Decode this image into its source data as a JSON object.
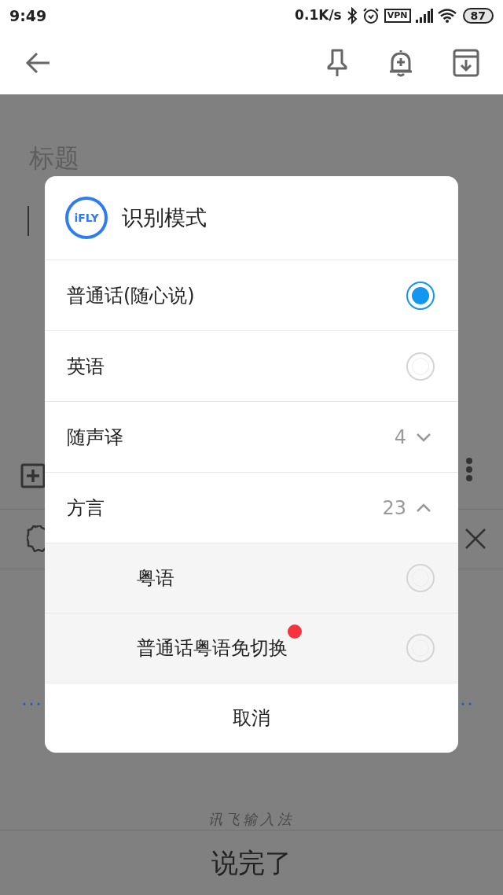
{
  "status_bar": {
    "time": "9:49",
    "speed": "0.1K/s",
    "vpn": "VPN",
    "battery": "87"
  },
  "note": {
    "title_placeholder": "标题"
  },
  "dialog": {
    "logo": "iFLY",
    "title": "识别模式",
    "options": [
      {
        "kind": "radio",
        "label": "普通话(随心说)",
        "selected": true
      },
      {
        "kind": "radio",
        "label": "英语",
        "selected": false
      },
      {
        "kind": "group",
        "label": "随声译",
        "count": "4",
        "expanded": false
      },
      {
        "kind": "group",
        "label": "方言",
        "count": "23",
        "expanded": true,
        "children": [
          {
            "label": "粤语",
            "selected": false,
            "new": false
          },
          {
            "label": "普通话粤语免切换",
            "selected": false,
            "new": true
          }
        ]
      }
    ],
    "cancel": "取消"
  },
  "keyboard": {
    "ime_name": "讯飞输入法",
    "done_button": "说完了"
  }
}
